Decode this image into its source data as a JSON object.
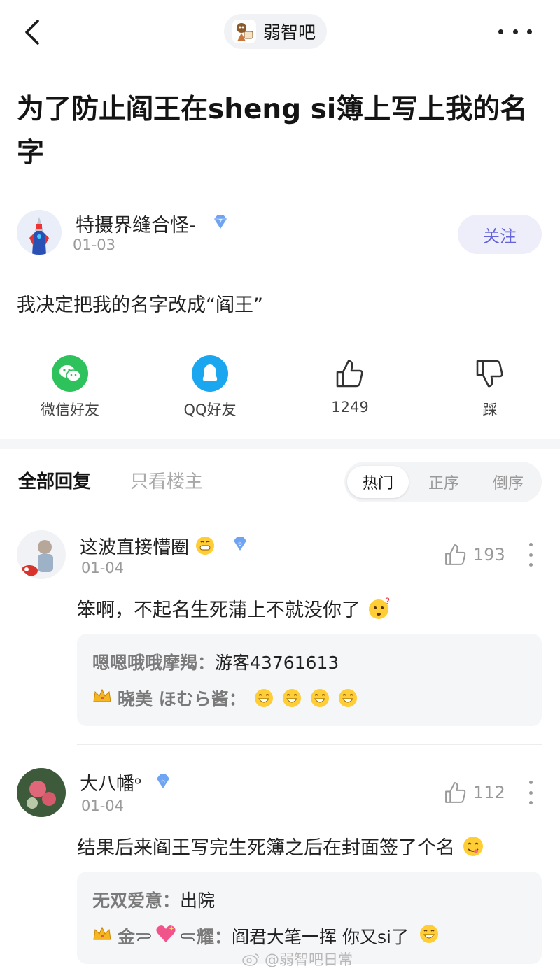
{
  "topbar": {
    "forum_name": "弱智吧",
    "more_icon": "more-dots-icon",
    "back_icon": "chevron-left-icon"
  },
  "post": {
    "title": "为了防止阎王在sheng si簿上写上我的名字",
    "author": {
      "name": "特摄界缝合怪-",
      "level": "7",
      "date": "01-03"
    },
    "follow_label": "关注",
    "body": "我决定把我的名字改成“阎王”"
  },
  "actions": {
    "wechat": "微信好友",
    "qq": "QQ好友",
    "like_count": "1249",
    "dislike": "踩"
  },
  "tabs": {
    "all": "全部回复",
    "op_only": "只看楼主",
    "sort": [
      "热门",
      "正序",
      "倒序"
    ]
  },
  "comments": [
    {
      "name": "这波直接懵圈",
      "level": "6",
      "date": "01-04",
      "likes": "193",
      "text": "笨啊，不起名生死蒲上不就没你了",
      "replies": [
        {
          "name": "嗯嗯哦哦摩羯：",
          "text": "游客43761613"
        },
        {
          "name": "晓美 ほむら酱：",
          "text": ""
        }
      ]
    },
    {
      "name": "大八幡ᵒ",
      "level": "6",
      "date": "01-04",
      "likes": "112",
      "text": "结果后来阎王写完生死簿之后在封面签了个名",
      "replies": [
        {
          "name": "无双爱意：",
          "text": "出院"
        },
        {
          "name_a": "金",
          "name_b": "耀：",
          "text": "阎君大笔一挥 你又si了"
        }
      ]
    }
  ],
  "watermark": "@弱智吧日常",
  "colors": {
    "accent": "#6464d8",
    "badge": "#5b8def",
    "wechat": "#2ec25c",
    "qq": "#1aa7ef"
  }
}
